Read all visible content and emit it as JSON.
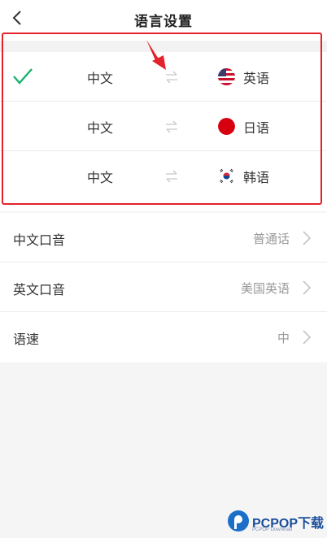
{
  "header": {
    "title": "语言设置",
    "back_icon": "chevron-left-icon"
  },
  "language_pairs": [
    {
      "source": "中文",
      "target": "英语",
      "flag": "us-flag-icon",
      "selected": true
    },
    {
      "source": "中文",
      "target": "日语",
      "flag": "japan-flag-icon",
      "selected": false
    },
    {
      "source": "中文",
      "target": "韩语",
      "flag": "korea-flag-icon",
      "selected": false
    }
  ],
  "settings": [
    {
      "label": "中文口音",
      "value": "普通话"
    },
    {
      "label": "英文口音",
      "value": "美国英语"
    },
    {
      "label": "语速",
      "value": "中"
    }
  ],
  "colors": {
    "check": "#19b36b",
    "highlight": "#e3222b",
    "swap_icon": "#c8c8c8"
  },
  "watermark": {
    "name": "PCPOP下载",
    "sub": "PCPOP Download"
  }
}
